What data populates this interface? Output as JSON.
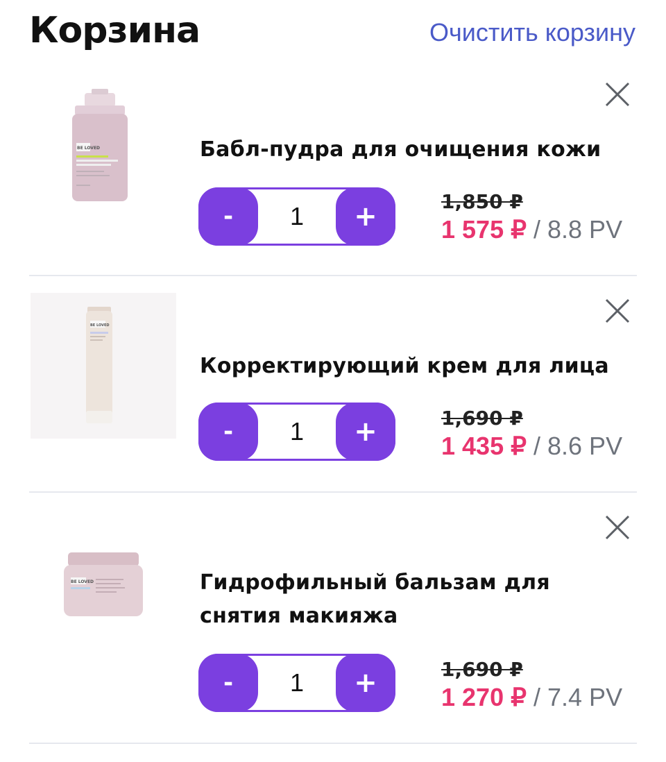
{
  "header": {
    "title": "Корзина",
    "clear_label": "Очистить корзину"
  },
  "colors": {
    "accent": "#7b3fe0",
    "price": "#e8346e",
    "link": "#4a5ac8"
  },
  "items": [
    {
      "name": "Бабл-пудра для очищения кожи",
      "brand_text": "BE LOVED",
      "quantity": "1",
      "old_price": "1,850 ₽",
      "new_price": "1 575 ₽",
      "pv": " / 8.8 PV"
    },
    {
      "name": "Корректирующий крем для лица",
      "brand_text": "BE LOVED",
      "quantity": "1",
      "old_price": "1,690 ₽",
      "new_price": "1 435 ₽",
      "pv": " / 8.6 PV"
    },
    {
      "name": "Гидрофильный бальзам для снятия макияжа",
      "brand_text": "BE LOVED",
      "quantity": "1",
      "old_price": "1,690 ₽",
      "new_price": "1 270 ₽",
      "pv": " / 7.4 PV"
    }
  ],
  "stepper": {
    "minus": "-",
    "plus": "+"
  },
  "icons": {
    "remove": "close-icon"
  }
}
